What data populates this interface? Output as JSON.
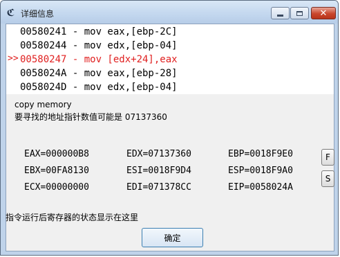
{
  "window": {
    "title": "详细信息",
    "app_icon": "cheat-engine-icon"
  },
  "code": {
    "current_marker": ">>",
    "lines": [
      {
        "text": "00580241 - mov eax,[ebp-2C]",
        "active": false
      },
      {
        "text": "00580244 - mov edx,[ebp-04]",
        "active": false
      },
      {
        "text": "00580247 - mov [edx+24],eax",
        "active": true
      },
      {
        "text": "0058024A - mov eax,[ebp-28]",
        "active": false
      },
      {
        "text": "0058024D - mov edx,[ebp-04]",
        "active": false
      }
    ]
  },
  "info": {
    "line1": "copy memory",
    "line2": "要寻找的地址指针数值可能是 07137360"
  },
  "registers": {
    "eax": "EAX=000000B8",
    "ebx": "EBX=00FA8130",
    "ecx": "ECX=00000000",
    "edx": "EDX=07137360",
    "esi": "ESI=0018F9D4",
    "edi": "EDI=071378CC",
    "ebp": "EBP=0018F9E0",
    "esp": "ESP=0018F9A0",
    "eip": "EIP=0058024A"
  },
  "buttons": {
    "f": "F",
    "s": "S",
    "ok": "确定"
  },
  "status": "指令运行后寄存器的状态显示在这里",
  "colors": {
    "active_line": "#e02020",
    "title_bar": "#c4d8ef",
    "close_button": "#c9462c"
  }
}
